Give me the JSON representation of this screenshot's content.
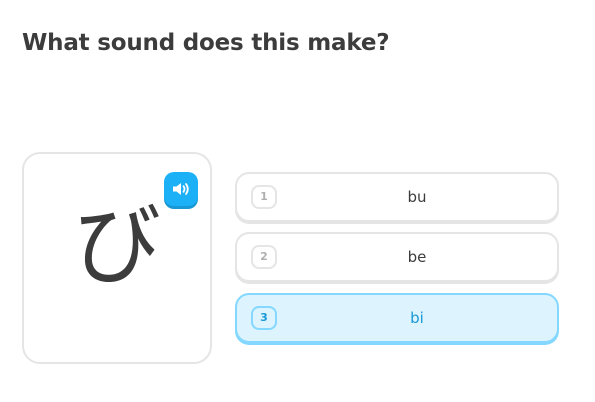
{
  "prompt": {
    "title": "What sound does this make?"
  },
  "character_card": {
    "character": "び",
    "audio_icon": "speaker-icon",
    "accent_color": "#1cb0f6"
  },
  "options": [
    {
      "key": "1",
      "label": "bu",
      "selected": false
    },
    {
      "key": "2",
      "label": "be",
      "selected": false
    },
    {
      "key": "3",
      "label": "bi",
      "selected": true
    }
  ],
  "colors": {
    "selected_background": "#ddf4ff",
    "selected_border": "#84d8ff",
    "selected_text": "#1899d6",
    "default_border": "#e5e5e5"
  }
}
